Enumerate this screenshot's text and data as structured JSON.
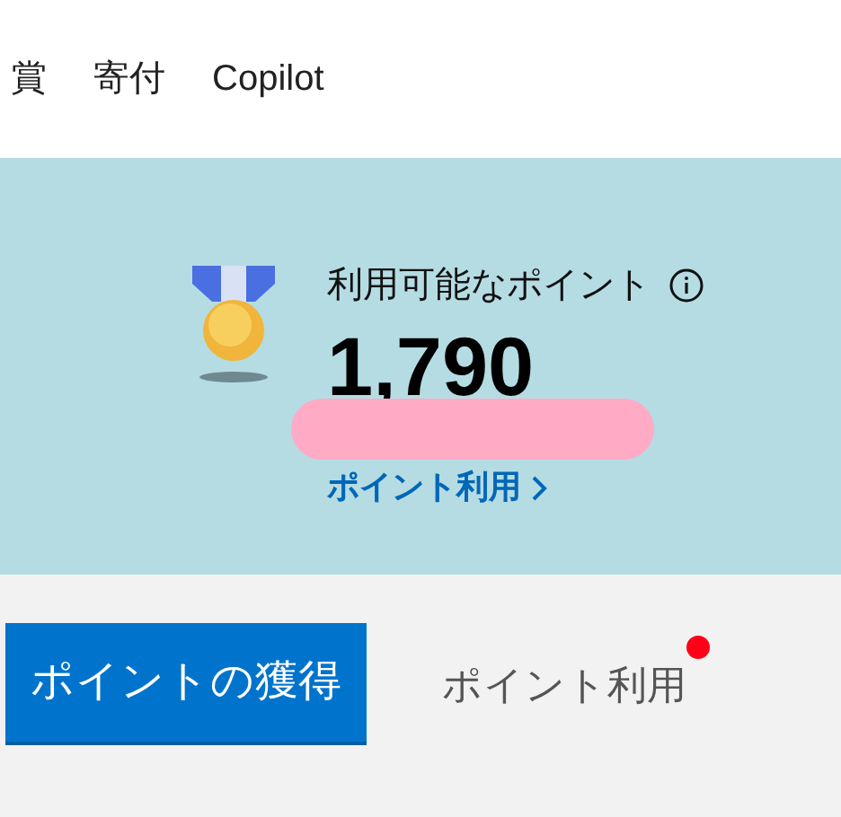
{
  "top_nav": [
    {
      "label": "賞"
    },
    {
      "label": "寄付"
    },
    {
      "label": "Copilot"
    }
  ],
  "points": {
    "label": "利用可能なポイント",
    "value": "1,790",
    "link": "ポイント利用"
  },
  "tabs": [
    {
      "label": "ポイントの獲得",
      "selected": true,
      "notification": false
    },
    {
      "label": "ポイント利用",
      "selected": false,
      "notification": true
    }
  ]
}
